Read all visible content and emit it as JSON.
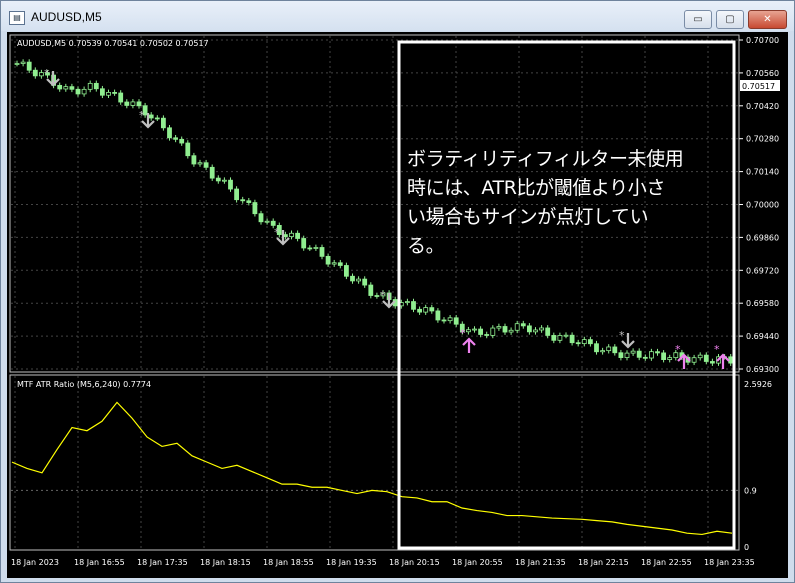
{
  "window": {
    "title": "AUDUSD,M5",
    "app_icon": "mt4-chart-icon",
    "minimize": "▭",
    "maximize": "▢",
    "close": "✕"
  },
  "main": {
    "header": "AUDUSD,M5  0.70539 0.70541 0.70502 0.70517",
    "price_ticks": [
      "0.70700",
      "0.70560",
      "0.70420",
      "0.70280",
      "0.70140",
      "0.70000",
      "0.69860",
      "0.69720",
      "0.69580",
      "0.69440",
      "0.69300"
    ],
    "current_price": "0.70517",
    "price_range": [
      0.693,
      0.707
    ]
  },
  "indicator": {
    "header": "MTF ATR Ratio (M5,6,240) 0.7774",
    "ticks": [
      "2.5926",
      "0.9",
      "0"
    ],
    "range": [
      0,
      2.5926
    ],
    "level": 0.9,
    "values": [
      1.35,
      1.25,
      1.18,
      1.55,
      1.9,
      1.85,
      2.0,
      2.3,
      2.05,
      1.75,
      1.6,
      1.65,
      1.45,
      1.35,
      1.25,
      1.3,
      1.2,
      1.1,
      1.0,
      1.0,
      0.95,
      0.95,
      0.9,
      0.85,
      0.9,
      0.88,
      0.8,
      0.78,
      0.72,
      0.72,
      0.62,
      0.58,
      0.55,
      0.5,
      0.5,
      0.48,
      0.46,
      0.45,
      0.44,
      0.42,
      0.4,
      0.36,
      0.33,
      0.3,
      0.27,
      0.22,
      0.2,
      0.25,
      0.22
    ],
    "line_color": "#ffff00"
  },
  "time_axis": [
    "18 Jan 2023",
    "18 Jan 16:55",
    "18 Jan 17:35",
    "18 Jan 18:15",
    "18 Jan 18:55",
    "18 Jan 19:35",
    "18 Jan 20:15",
    "18 Jan 20:55",
    "18 Jan 21:35",
    "18 Jan 22:15",
    "18 Jan 22:55",
    "18 Jan 23:35"
  ],
  "annotation": {
    "text_lines": [
      "ボラティリティフィルター未使用",
      "時には、ATR比が閾値より小さ",
      "い場合もサインが点灯してい",
      "る。"
    ],
    "box_color": "#ffffff"
  },
  "signals": {
    "sell_color": "#c0c0c0",
    "buy_color": "#ee82ee"
  },
  "colors": {
    "candle": "#90ee90",
    "grid": "#3a3a3a",
    "background": "#000000"
  }
}
